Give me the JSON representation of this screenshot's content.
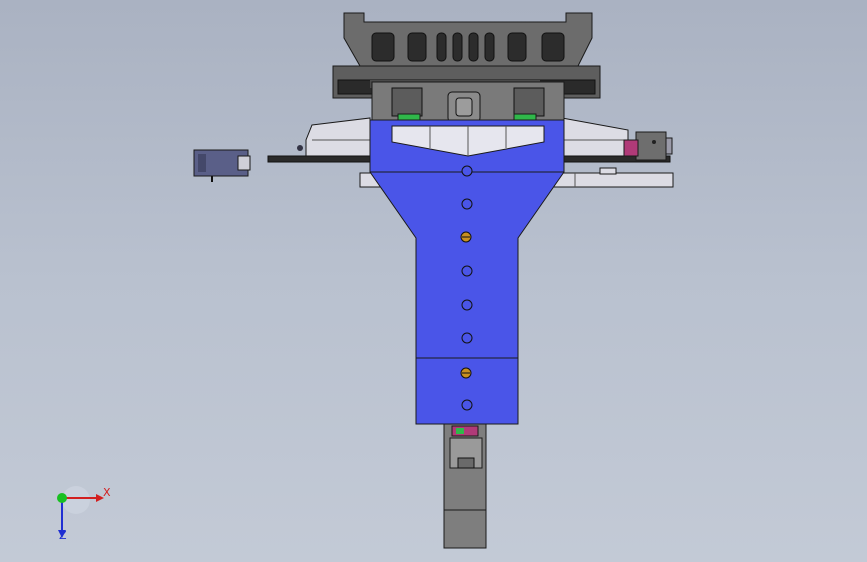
{
  "viewport": {
    "background_top": "#aab2c2",
    "background_bottom": "#c3cad6"
  },
  "model": {
    "part_fill_blue": "#4a55e8",
    "part_fill_gray": "#6b6b6b",
    "part_fill_light": "#dcdce4",
    "edge_color": "#1a1a1a",
    "screw_color": "#c8901e",
    "bracket_color": "#b03a78",
    "clip_color": "#2fb84a"
  },
  "triad": {
    "x_label": "X",
    "z_label": "Z",
    "x_color": "#d21f1f",
    "y_color": "#18c021",
    "z_color": "#1f2fd2"
  }
}
